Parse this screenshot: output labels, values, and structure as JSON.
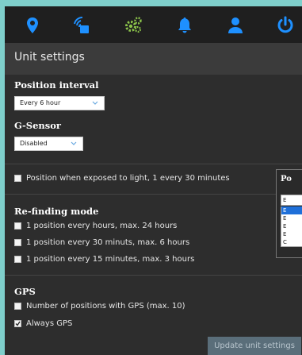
{
  "nav": {
    "icons": [
      "location-pin-icon",
      "signal-device-icon",
      "gears-icon",
      "bell-icon",
      "user-icon",
      "power-icon"
    ],
    "accent_color": "#1e90ff",
    "gear_color": "#8bc34a"
  },
  "header": {
    "title": "Unit settings"
  },
  "position_interval": {
    "heading": "Position interval",
    "selected": "Every 6 hour"
  },
  "g_sensor": {
    "heading": "G-Sensor",
    "selected": "Disabled"
  },
  "light": {
    "label": "Position when exposed to light, 1 every 30 minutes",
    "checked": false
  },
  "refinding": {
    "heading": "Re-finding mode",
    "options": [
      {
        "label": "1 position every hours, max. 24 hours",
        "checked": false
      },
      {
        "label": "1 position every 30 minuts, max. 6 hours",
        "checked": false
      },
      {
        "label": "1 position every 15 minutes, max. 3 hours",
        "checked": false
      }
    ]
  },
  "gps": {
    "heading": "GPS",
    "options": [
      {
        "label": "Number of positions with GPS (max. 10)",
        "checked": false
      },
      {
        "label": "Always GPS",
        "checked": true
      }
    ]
  },
  "popup": {
    "title": "Po",
    "selected": "E",
    "options": [
      "E",
      "E",
      "E",
      "E",
      "C"
    ]
  },
  "footer": {
    "update_label": "Update unit settings"
  }
}
